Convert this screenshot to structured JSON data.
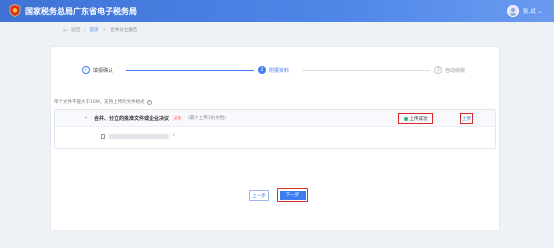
{
  "header": {
    "site_title": "国家税务总局广东省电子税务局",
    "user_name": "张,试 ⌄"
  },
  "breadcrumb": {
    "back": "←",
    "back_label": "返回",
    "home": "首页",
    "separator": ">",
    "current": "合并分立报告"
  },
  "steps": [
    {
      "number": "✓",
      "label": "填报确认",
      "state": "done"
    },
    {
      "number": "2",
      "label": "附报资料",
      "state": "active"
    },
    {
      "number": "3",
      "label": "自动纳税",
      "state": "pending"
    }
  ],
  "upload": {
    "hint": "单个文件不能大于10M，支持上传的文件格式",
    "info_icon": "i",
    "documents": [
      {
        "chevron": "⌄",
        "name": "合并、分立的批准文件或企业决议",
        "required_tag": "必传",
        "required_note": "(最少上传1份文档)",
        "status": "上传成功",
        "action": "上传",
        "file_remove": "×"
      }
    ]
  },
  "buttons": {
    "prev": "上一步",
    "next": "下一步"
  },
  "colors": {
    "primary": "#3c7ef0",
    "header": "#4e86e8",
    "success": "#2cb56c",
    "highlight": "#d52b2b"
  }
}
